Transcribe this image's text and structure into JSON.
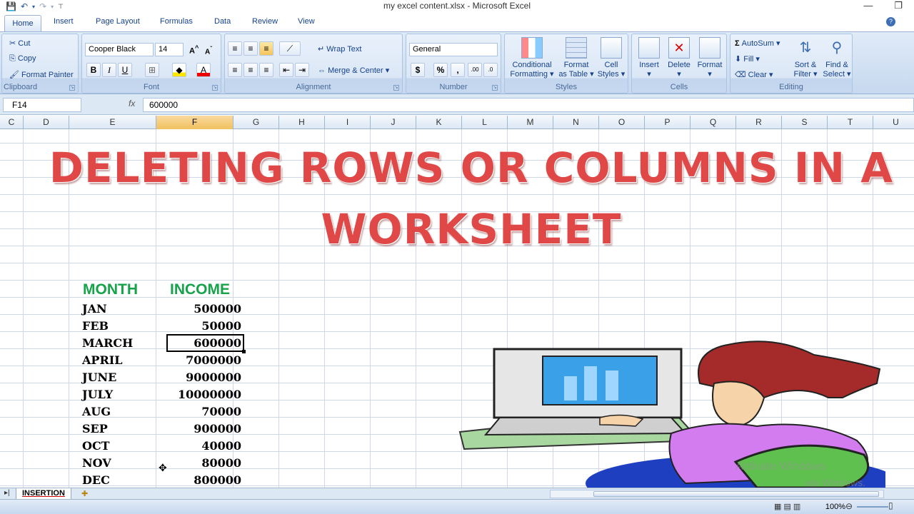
{
  "window": {
    "title": "my excel content.xlsx - Microsoft Excel"
  },
  "ribbon_tabs": [
    "Home",
    "Insert",
    "Page Layout",
    "Formulas",
    "Data",
    "Review",
    "View"
  ],
  "clipboard": {
    "cut": "Cut",
    "copy": "Copy",
    "format_painter": "Format Painter",
    "label": "Clipboard"
  },
  "font": {
    "name": "Cooper Black",
    "size": "14",
    "label": "Font",
    "bold": "B",
    "italic": "I",
    "underline": "U"
  },
  "alignment": {
    "wrap": "Wrap Text",
    "merge": "Merge & Center",
    "label": "Alignment"
  },
  "number": {
    "format": "General",
    "label": "Number",
    "currency": "$",
    "percent": "%",
    "comma": ","
  },
  "styles": {
    "conditional": "Conditional",
    "formatting": "Formatting",
    "format": "Format",
    "as_table": "as Table",
    "cell": "Cell",
    "cell_styles": "Styles",
    "label": "Styles"
  },
  "cells": {
    "insert": "Insert",
    "delete": "Delete",
    "format": "Format",
    "label": "Cells"
  },
  "editing": {
    "autosum": "AutoSum",
    "fill": "Fill",
    "clear": "Clear",
    "sort": "Sort &",
    "filter": "Filter",
    "find": "Find &",
    "select": "Select",
    "label": "Editing"
  },
  "formula_bar": {
    "name_box": "F14",
    "fx": "fx",
    "value": "600000"
  },
  "columns": [
    "C",
    "D",
    "E",
    "F",
    "G",
    "H",
    "I",
    "J",
    "K",
    "L",
    "M",
    "N",
    "O",
    "P",
    "Q",
    "R",
    "S",
    "T",
    "U"
  ],
  "selected_column": "F",
  "sheet_title_line1": "DELETING ROWS OR COLUMNS IN A",
  "sheet_title_line2": "WORKSHEET",
  "table": {
    "headers": [
      "MONTH",
      "INCOME"
    ],
    "rows": [
      [
        "JAN",
        "500000"
      ],
      [
        "FEB",
        "50000"
      ],
      [
        "MARCH",
        "600000"
      ],
      [
        "APRIL",
        "7000000"
      ],
      [
        "JUNE",
        "9000000"
      ],
      [
        "JULY",
        "10000000"
      ],
      [
        "AUG",
        "70000"
      ],
      [
        "SEP",
        "900000"
      ],
      [
        "OCT",
        "40000"
      ],
      [
        "NOV",
        "80000"
      ],
      [
        "DEC",
        "800000"
      ]
    ]
  },
  "sheet_tabs": [
    "INSERTION"
  ],
  "status": {
    "zoom": "100%"
  },
  "watermark": {
    "line1": "Activate Windows",
    "line2": "ate Windows."
  },
  "colors": {
    "title_red": "#e04848",
    "header_green": "#16a34a",
    "ribbon_blue": "#c6d8ef",
    "selected_header": "#f1c15f"
  }
}
